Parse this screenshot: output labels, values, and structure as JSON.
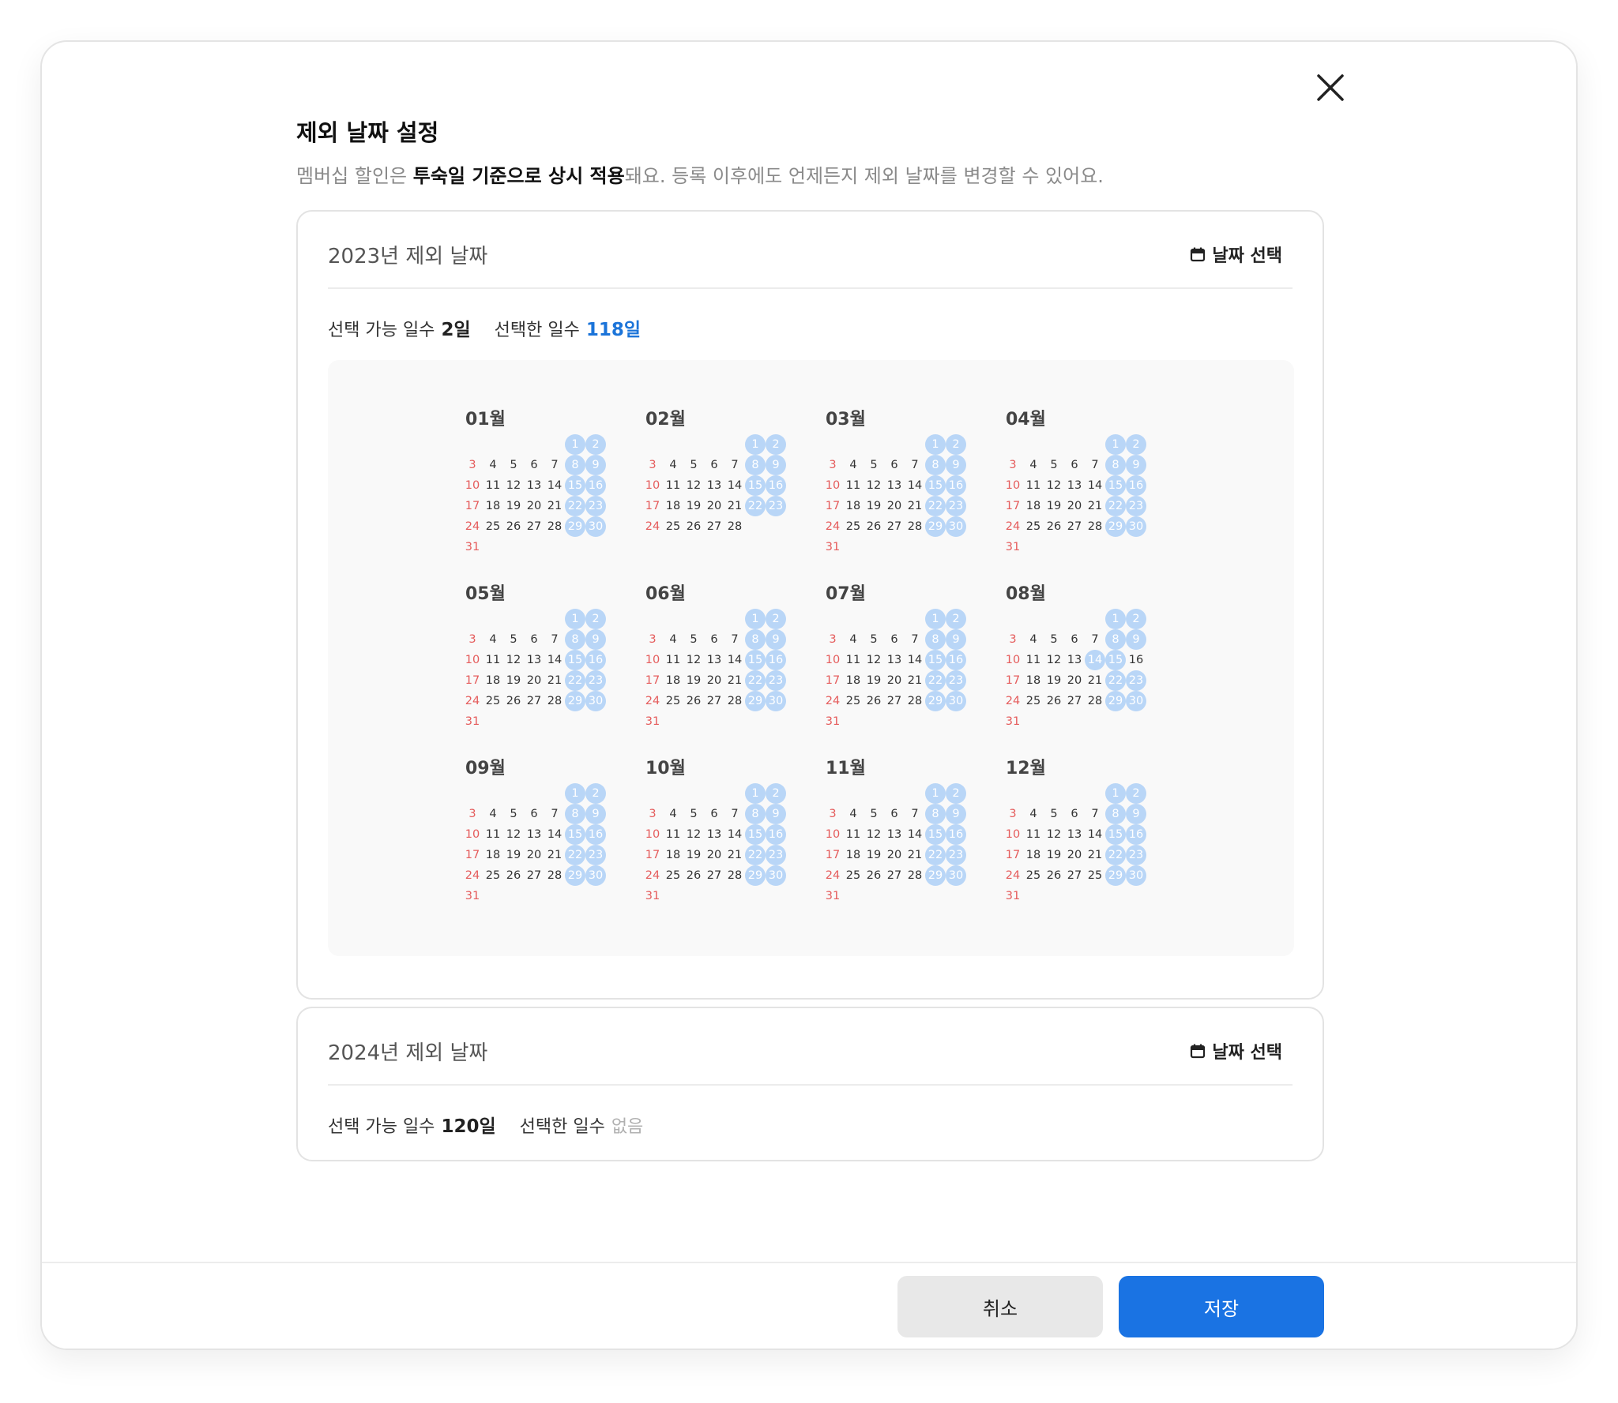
{
  "modal": {
    "title": "제외 날짜 설정",
    "subtitle": {
      "part1": "멤버십 할인은 ",
      "bold": "투숙일 기준으로 상시 적용",
      "part2": "돼요. 등록 이후에도 언제든지 제외 날짜를 변경할 수 있어요."
    },
    "close_icon": "close-icon"
  },
  "cards": [
    {
      "title": "2023년 제외 날짜",
      "date_select_label": "날짜 선택",
      "available_label": "선택 가능 일수",
      "available_value": "2일",
      "selected_label": "선택한 일수",
      "selected_value": "118일",
      "months": [
        {
          "name": "01월",
          "last": 31,
          "selected": [
            1,
            2,
            8,
            9,
            15,
            16,
            22,
            23,
            29,
            30
          ]
        },
        {
          "name": "02월",
          "last": 28,
          "selected": [
            1,
            2,
            8,
            9,
            15,
            16,
            22,
            23
          ]
        },
        {
          "name": "03월",
          "last": 31,
          "selected": [
            1,
            2,
            8,
            9,
            15,
            16,
            22,
            23,
            29,
            30
          ]
        },
        {
          "name": "04월",
          "last": 31,
          "selected": [
            1,
            2,
            8,
            9,
            15,
            16,
            22,
            23,
            29,
            30
          ]
        },
        {
          "name": "05월",
          "last": 31,
          "selected": [
            1,
            2,
            8,
            9,
            15,
            16,
            22,
            23,
            29,
            30
          ]
        },
        {
          "name": "06월",
          "last": 31,
          "selected": [
            1,
            2,
            8,
            9,
            15,
            16,
            22,
            23,
            29,
            30
          ]
        },
        {
          "name": "07월",
          "last": 31,
          "selected": [
            1,
            2,
            8,
            9,
            15,
            16,
            22,
            23,
            29,
            30
          ]
        },
        {
          "name": "08월",
          "last": 31,
          "selected": [
            1,
            2,
            8,
            9,
            14,
            15,
            22,
            23,
            29,
            30
          ],
          "override": {
            "14": "14"
          }
        },
        {
          "name": "09월",
          "last": 31,
          "selected": [
            1,
            2,
            8,
            9,
            15,
            16,
            22,
            23,
            29,
            30
          ]
        },
        {
          "name": "10월",
          "last": 31,
          "selected": [
            1,
            2,
            8,
            9,
            15,
            16,
            22,
            23,
            29,
            30
          ]
        },
        {
          "name": "11월",
          "last": 31,
          "selected": [
            1,
            2,
            8,
            9,
            15,
            16,
            22,
            23,
            29,
            30
          ]
        },
        {
          "name": "12월",
          "last": 31,
          "selected": [
            1,
            2,
            8,
            9,
            15,
            16,
            22,
            23,
            29,
            30
          ],
          "override": {
            "28": "25"
          }
        }
      ]
    },
    {
      "title": "2024년 제외 날짜",
      "date_select_label": "날짜 선택",
      "available_label": "선택 가능 일수",
      "available_value": "120일",
      "selected_label": "선택한 일수",
      "selected_value": "없음"
    }
  ],
  "footer": {
    "cancel_label": "취소",
    "save_label": "저장"
  },
  "colors": {
    "accent": "#1a73e3",
    "selected_day": "#b9d6f7",
    "sunday": "#e55b5b",
    "selected_count": "#1b74d9"
  }
}
